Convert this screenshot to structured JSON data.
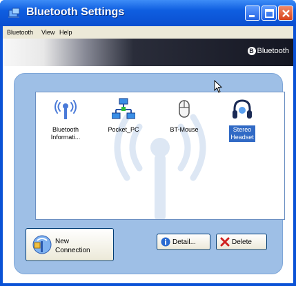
{
  "window": {
    "title": "Bluetooth Settings",
    "icon": "bluetooth-app-icon",
    "controls": [
      "minimize-icon",
      "maximize-icon",
      "close-icon"
    ]
  },
  "menu": [
    {
      "label": "Bluetooth"
    },
    {
      "label": "View"
    },
    {
      "label": "Help"
    }
  ],
  "banner": {
    "logo_text": "Bluetooth",
    "logo_glyph": "B"
  },
  "devices": [
    {
      "label1": "Bluetooth",
      "label2": "Informati...",
      "icon": "bluetooth-info-icon",
      "selected": false
    },
    {
      "label1": "Pocket_PC",
      "label2": "",
      "icon": "network-icon",
      "selected": false
    },
    {
      "label1": "BT-Mouse",
      "label2": "",
      "icon": "mouse-icon",
      "selected": false
    },
    {
      "label1": "Stereo",
      "label2": "Headset",
      "icon": "headset-icon",
      "selected": true
    }
  ],
  "buttons": {
    "new_connection_line1": "New",
    "new_connection_line2": "Connection",
    "detail": "Detail...",
    "delete": "Delete"
  }
}
